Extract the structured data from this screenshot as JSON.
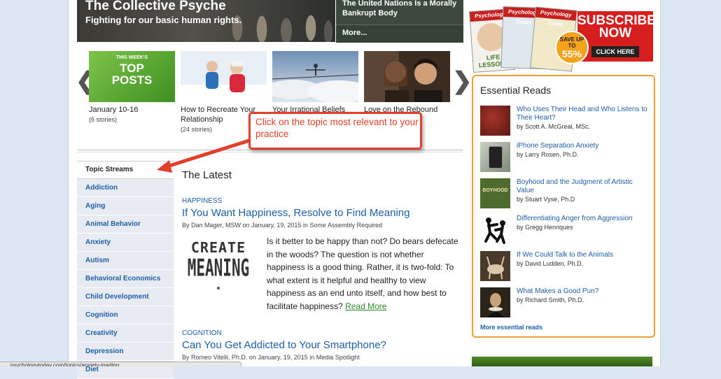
{
  "hero": {
    "title": "The Collective Psyche",
    "subtitle": "Fighting for our basic human rights.",
    "side_text": "The United Nations Is a Morally Bankrupt Body",
    "side_more": "More..."
  },
  "subscribe": {
    "magazine_brand": "Psychology Today",
    "magazine_label": "LIFE LESSONS",
    "cta_title": "SUBSCRIBE NOW",
    "save_text": "SAVE UP TO",
    "save_value": "55%",
    "button": "CLICK HERE"
  },
  "carousel": {
    "prev": "❮",
    "next": "❯",
    "items": [
      {
        "thumb_line1": "THIS WEEK'S",
        "thumb_line2": "TOP POSTS",
        "title": "January 10-16",
        "count": "(6 stories)"
      },
      {
        "title": "How to Recreate Your Relationship",
        "count": "(24 stories)"
      },
      {
        "title": "Your Irrational Beliefs",
        "count": ""
      },
      {
        "title": "Love on the Rebound",
        "count": ""
      }
    ]
  },
  "callout": {
    "text": "Click on the topic most relevant to your practice",
    "color": "#e2402a"
  },
  "topics": {
    "heading": "Topic Streams",
    "items": [
      "Addiction",
      "Aging",
      "Animal Behavior",
      "Anxiety",
      "Autism",
      "Behavioral Economics",
      "Child Development",
      "Cognition",
      "Creativity",
      "Depression",
      "Diet"
    ]
  },
  "latest": {
    "heading": "The Latest",
    "articles": [
      {
        "category": "HAPPINESS",
        "title": "If You Want Happiness, Resolve to Find Meaning",
        "byline": "By Dan Mager, MSW on January, 19, 2015 in Some Assembly Required",
        "image_line1": "CREATE",
        "image_line2": "MEANING",
        "excerpt": "Is it better to be happy than not? Do bears defecate in the woods? The question is not whether happiness is a good thing. Rather, it is two-fold: To what extent is it helpful and healthy to view happiness as an end unto itself, and how best to facilitate happiness?",
        "read_more": "Read More"
      },
      {
        "category": "COGNITION",
        "title": "Can You Get Addicted to Your Smartphone?",
        "byline": "By Romeo Vitelli, Ph.D. on January, 19, 2015 in Media Spotlight"
      }
    ]
  },
  "essential_reads": {
    "title": "Essential Reads",
    "items": [
      {
        "title": "Who Uses Their Head and Who Listens to Their Heart?",
        "author": "by Scott A. McGreal, MSc."
      },
      {
        "title": "iPhone Separation Anxiety",
        "author": "by Larry Rosen, Ph.D."
      },
      {
        "title": "Boyhood and the Judgment of Artistic Value",
        "author": "by Stuart Vyse, Ph.D",
        "thumb_text": "BOYHOOD"
      },
      {
        "title": "Differentiating Anger from Aggression",
        "author": "by Gregg Henriques"
      },
      {
        "title": "If We Could Talk to the Animals",
        "author": "by David Ludden, Ph.D."
      },
      {
        "title": "What Makes a Good Pun?",
        "author": "by Richard Smith, Ph.D."
      }
    ],
    "more": "More essential reads"
  },
  "status": {
    "text": "...psychologytoday.com/topics/anxiety-loading..."
  }
}
